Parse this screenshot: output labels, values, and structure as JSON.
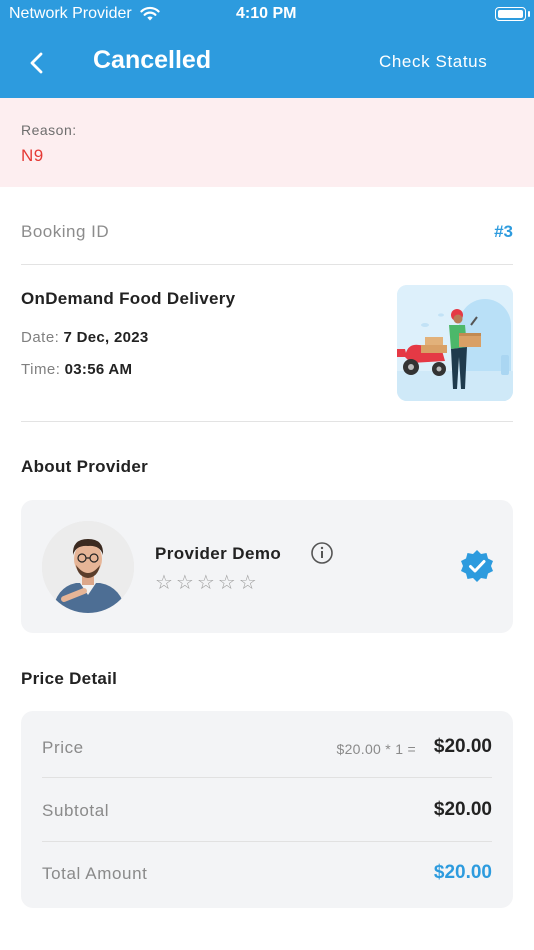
{
  "status_bar": {
    "carrier": "Network Provider",
    "time": "4:10 PM"
  },
  "header": {
    "title": "Cancelled",
    "check_status": "Check Status"
  },
  "reason": {
    "label": "Reason:",
    "value": "N9"
  },
  "booking": {
    "label": "Booking ID",
    "id": "#3"
  },
  "service": {
    "name": "OnDemand Food Delivery",
    "date_label": "Date:",
    "date_value": "7 Dec, 2023",
    "time_label": "Time:",
    "time_value": "03:56 AM"
  },
  "provider": {
    "section_title": "About Provider",
    "name": "Provider Demo",
    "rating_stars": "☆☆☆☆☆",
    "rating": 0
  },
  "price": {
    "section_title": "Price Detail",
    "price_label": "Price",
    "price_calc": "$20.00 * 1  =",
    "price_amount": "$20.00",
    "subtotal_label": "Subtotal",
    "subtotal_amount": "$20.00",
    "total_label": "Total Amount",
    "total_amount": "$20.00"
  },
  "colors": {
    "primary": "#2d9bde",
    "reason_bg": "#fdeef0",
    "reason_text": "#e53935",
    "card_bg": "#f3f4f6"
  }
}
